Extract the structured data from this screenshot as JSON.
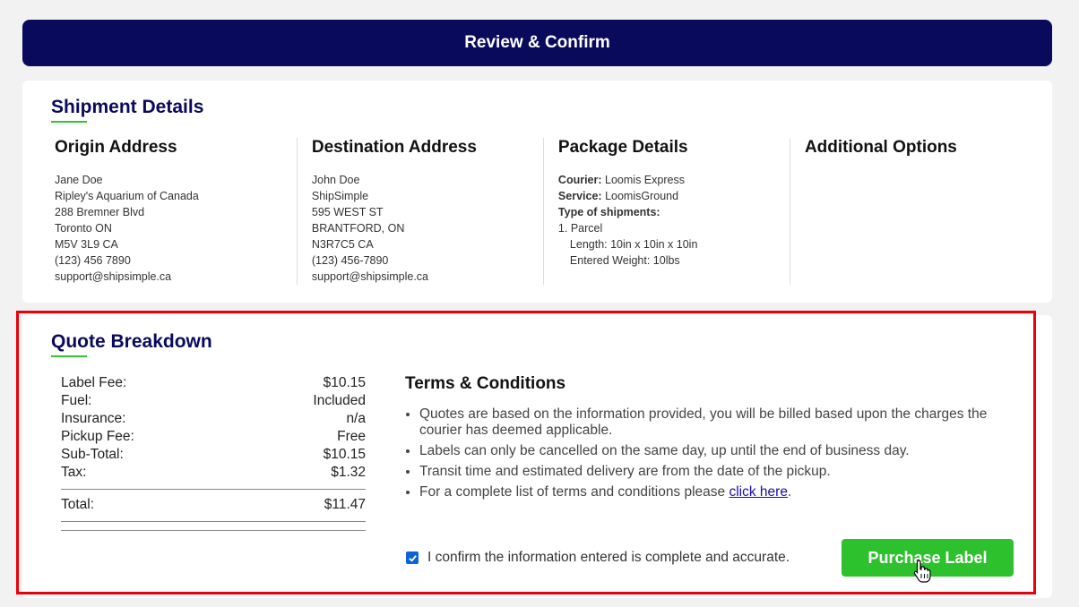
{
  "header": {
    "title": "Review & Confirm"
  },
  "shipment": {
    "title": "Shipment Details",
    "origin": {
      "title": "Origin Address",
      "lines": [
        "Jane Doe",
        "Ripley's Aquarium of Canada",
        "288 Bremner Blvd",
        "Toronto ON",
        "M5V 3L9 CA",
        "(123) 456 7890",
        "support@shipsimple.ca"
      ]
    },
    "destination": {
      "title": "Destination Address",
      "lines": [
        "John Doe",
        "ShipSimple",
        "595 WEST ST",
        "BRANTFORD, ON",
        "N3R7C5 CA",
        "(123) 456-7890",
        "support@shipsimple.ca"
      ]
    },
    "package": {
      "title": "Package Details",
      "courier_label": "Courier:",
      "courier": "Loomis Express",
      "service_label": "Service:",
      "service": "LoomisGround",
      "types_label": "Type of shipments:",
      "item": "1. Parcel",
      "length": "Length: 10in x 10in x 10in",
      "weight": "Entered Weight: 10lbs"
    },
    "additional": {
      "title": "Additional Options"
    }
  },
  "quote": {
    "title": "Quote Breakdown",
    "fees": [
      {
        "label": "Label Fee:",
        "value": "$10.15"
      },
      {
        "label": "Fuel:",
        "value": "Included"
      },
      {
        "label": "Insurance:",
        "value": "n/a"
      },
      {
        "label": "Pickup Fee:",
        "value": "Free"
      },
      {
        "label": "Sub-Total:",
        "value": "$10.15"
      },
      {
        "label": "Tax:",
        "value": "$1.32"
      }
    ],
    "total_label": "Total:",
    "total_value": "$11.47"
  },
  "terms": {
    "title": "Terms & Conditions",
    "items": [
      "Quotes are based on the information provided, you will be billed based upon the charges the courier has deemed applicable.",
      "Labels can only be cancelled on the same day, up until the end of business day.",
      "Transit time and estimated delivery are from the date of the pickup."
    ],
    "link_prefix": "For a complete list of terms and conditions please ",
    "link_text": "click here",
    "link_suffix": "."
  },
  "confirm": {
    "label": "I confirm the information entered is complete and accurate.",
    "checked": true
  },
  "purchase": {
    "label": "Purchase Label"
  },
  "colors": {
    "header": "#0a0a5c",
    "accent": "#2ec12e",
    "highlight": "#e8000b",
    "link": "#1a0dab"
  }
}
